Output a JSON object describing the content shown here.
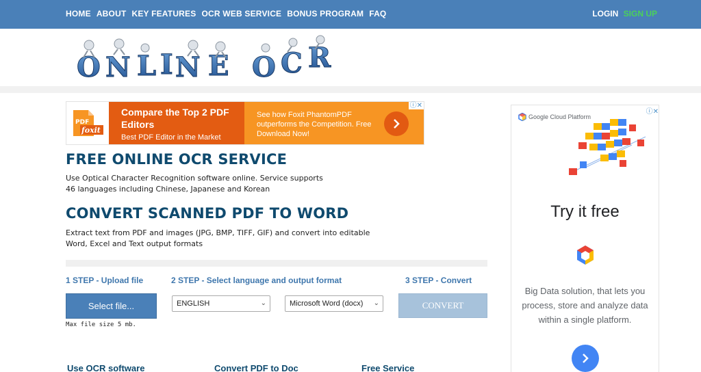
{
  "nav": {
    "left": [
      "HOME",
      "ABOUT",
      "KEY FEATURES",
      "OCR WEB SERVICE",
      "BONUS PROGRAM",
      "FAQ"
    ],
    "login": "LOGIN",
    "signup": "SIGN UP"
  },
  "logo": {
    "text": "ONLINE OCR"
  },
  "ad_banner": {
    "brand": "foxit",
    "headline": "Compare the Top 2 PDF Editors",
    "subline": "Best PDF Editor in the Market",
    "right_text": "See how Foxit PhantomPDF outperforms the Competition. Free Download Now!",
    "adchoices": "ⓘ✕"
  },
  "main": {
    "title1": "FREE ONLINE OCR SERVICE",
    "para1_line1": "Use Optical Character Recognition software online. Service supports",
    "para1_line2": "46 languages including Chinese, Japanese and Korean",
    "title2": "CONVERT SCANNED PDF TO WORD",
    "para2_line1": "Extract text from PDF and images (JPG, BMP, TIFF, GIF) and convert into editable",
    "para2_line2": "Word, Excel and Text output formats"
  },
  "steps": {
    "step1": "1 STEP - Upload file",
    "step2": "2 STEP - Select language and output format",
    "step3": "3 STEP - Convert",
    "select_file": "Select file...",
    "max_size": "Max file size 5 mb.",
    "language": "ENGLISH",
    "format": "Microsoft Word (docx)",
    "convert": "CONVERT"
  },
  "bottom": [
    "Use OCR software",
    "Convert PDF to Doc",
    "Free Service"
  ],
  "side_ad": {
    "brand": "Google Cloud Platform",
    "headline": "Try it free",
    "text": "Big Data solution, that lets you process, store and analyze data within a single platform.",
    "adchoices": "ⓘ✕"
  },
  "colors": {
    "nav_bg": "#4a80b8",
    "heading": "#0f4a6e",
    "step": "#3f77ad",
    "signup": "#4bd15a",
    "ad_orange_dark": "#e35c12",
    "ad_orange": "#f79523"
  }
}
